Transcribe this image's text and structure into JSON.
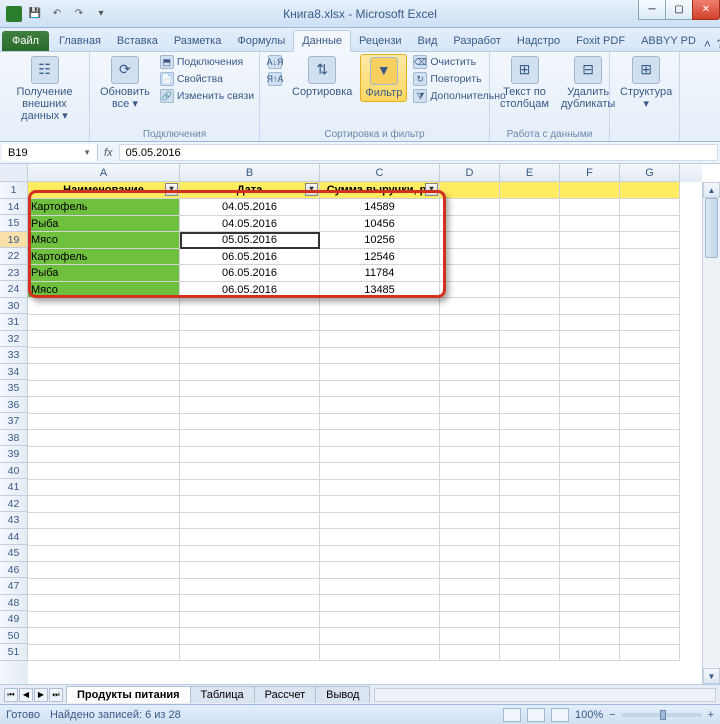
{
  "title": "Книга8.xlsx - Microsoft Excel",
  "tabs": {
    "file": "Файл",
    "list": [
      "Главная",
      "Вставка",
      "Разметка",
      "Формулы",
      "Данные",
      "Рецензи",
      "Вид",
      "Разработ",
      "Надстро",
      "Foxit PDF",
      "ABBYY PD"
    ],
    "active": "Данные"
  },
  "ribbon": {
    "g1": {
      "get_data": "Получение\nвнешних данных ▾",
      "label": ""
    },
    "g2": {
      "refresh": "Обновить\nвсе ▾",
      "conn": "Подключения",
      "props": "Свойства",
      "links": "Изменить связи",
      "label": "Подключения"
    },
    "g3": {
      "sort_az": "А↓Я",
      "sort_za": "Я↑А",
      "sort": "Сортировка",
      "filter": "Фильтр",
      "clear": "Очистить",
      "reapply": "Повторить",
      "adv": "Дополнительно",
      "label": "Сортировка и фильтр"
    },
    "g4": {
      "ttc": "Текст по\nстолбцам",
      "dup": "Удалить\nдубликаты",
      "label": "Работа с данными"
    },
    "g5": {
      "struct": "Структура\n▾",
      "label": ""
    }
  },
  "namebox": "B19",
  "formula": "05.05.2016",
  "cols": {
    "A": 152,
    "B": 140,
    "C": 120,
    "D": 60,
    "E": 60,
    "F": 60,
    "G": 60
  },
  "header_row": {
    "num": "1",
    "A": "Наименование",
    "B": "Дата",
    "C": "Сумма выручки, ру"
  },
  "data_rows": [
    {
      "num": "14",
      "A": "Картофель",
      "B": "04.05.2016",
      "C": "14589"
    },
    {
      "num": "15",
      "A": "Рыба",
      "B": "04.05.2016",
      "C": "10456"
    },
    {
      "num": "19",
      "A": "Мясо",
      "B": "05.05.2016",
      "C": "10256"
    },
    {
      "num": "22",
      "A": "Картофель",
      "B": "06.05.2016",
      "C": "12546"
    },
    {
      "num": "23",
      "A": "Рыба",
      "B": "06.05.2016",
      "C": "11784"
    },
    {
      "num": "24",
      "A": "Мясо",
      "B": "06.05.2016",
      "C": "13485"
    }
  ],
  "empty_rows": [
    "30",
    "31",
    "32",
    "33",
    "34",
    "35",
    "36",
    "37",
    "38",
    "39",
    "40",
    "41",
    "42",
    "43",
    "44",
    "45",
    "46",
    "47",
    "48",
    "49",
    "50",
    "51"
  ],
  "sheets": {
    "active": "Продукты питания",
    "others": [
      "Таблица",
      "Рассчет",
      "Вывод"
    ]
  },
  "status": {
    "ready": "Готово",
    "found": "Найдено записей: 6 из 28",
    "zoom": "100%"
  }
}
